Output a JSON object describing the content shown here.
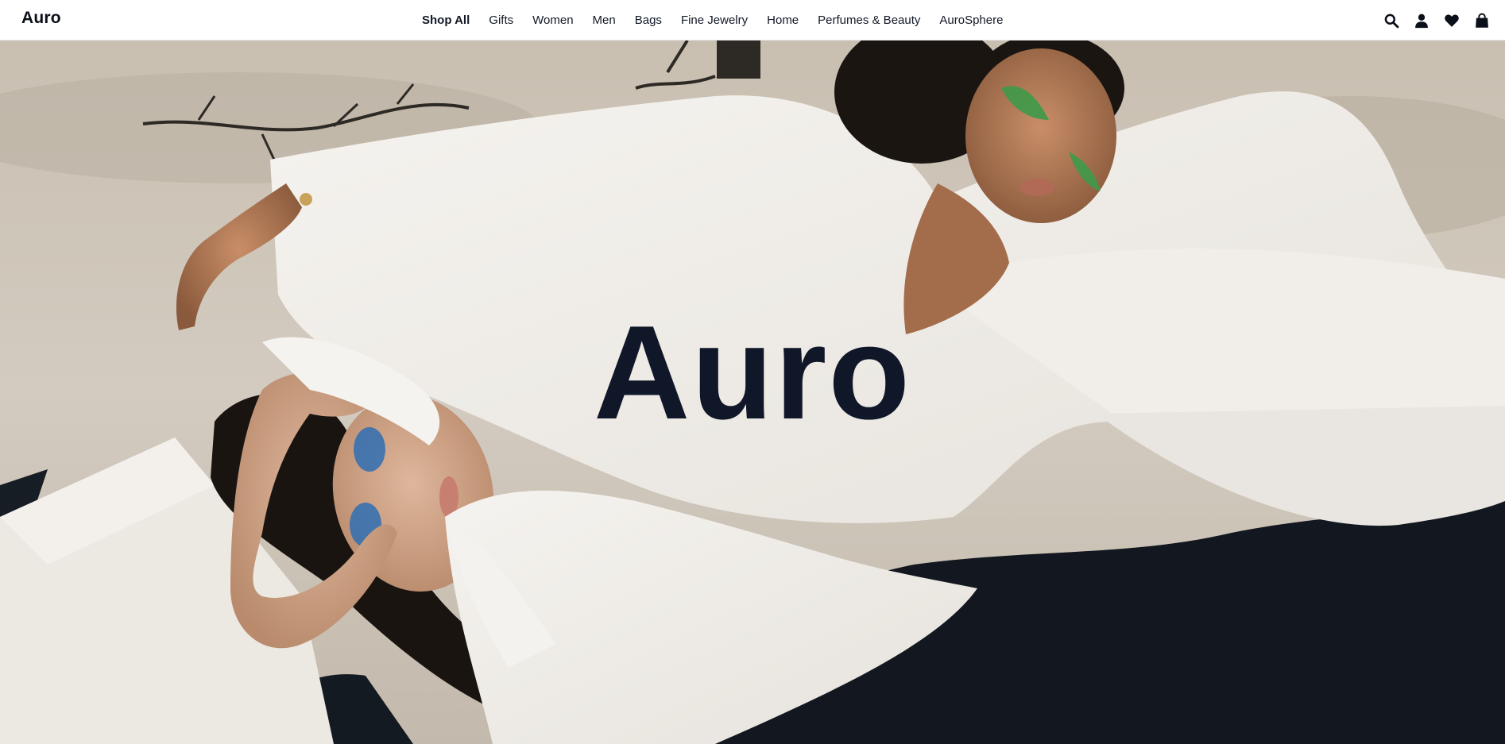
{
  "header": {
    "logo": "Auro",
    "nav": [
      {
        "label": "Shop All",
        "active": true
      },
      {
        "label": "Gifts",
        "active": false
      },
      {
        "label": "Women",
        "active": false
      },
      {
        "label": "Men",
        "active": false
      },
      {
        "label": "Bags",
        "active": false
      },
      {
        "label": "Fine Jewelry",
        "active": false
      },
      {
        "label": "Home",
        "active": false
      },
      {
        "label": "Perfumes & Beauty",
        "active": false
      },
      {
        "label": "AuroSphere",
        "active": false
      }
    ],
    "icons": [
      "search-icon",
      "account-icon",
      "wishlist-heart-icon",
      "shopping-bag-icon"
    ]
  },
  "hero": {
    "title": "Auro",
    "image": "two-models-in-white-shirts-lying-on-fabric"
  },
  "colors": {
    "title": "#0f1729",
    "header_bg": "#ffffff",
    "text": "#111827"
  }
}
